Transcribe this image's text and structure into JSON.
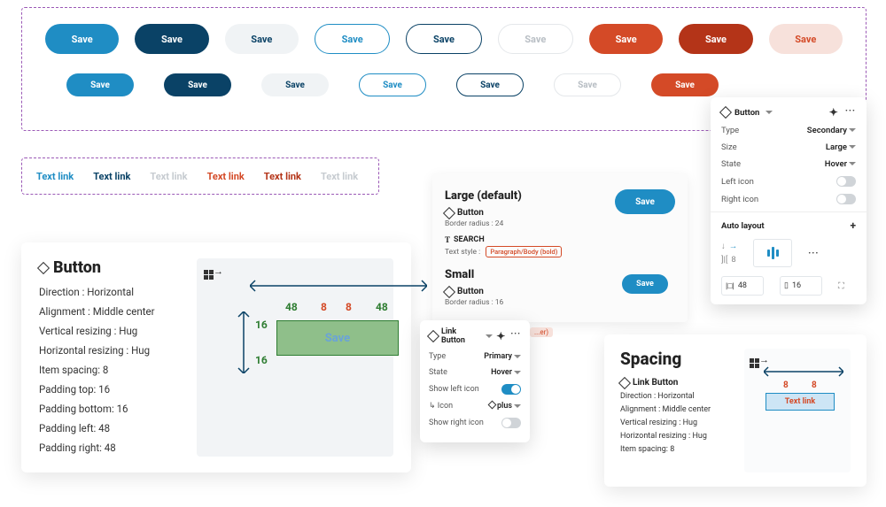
{
  "buttons": {
    "label": "Save",
    "row1_classes": [
      "fill-blue",
      "fill-navy",
      "fill-gray",
      "out-blue",
      "out-navy",
      "out-gray",
      "fill-red",
      "fill-dred",
      "fill-pink"
    ],
    "row2_classes": [
      "fill-blue",
      "fill-navy",
      "fill-gray",
      "out-blue",
      "out-navy",
      "out-gray",
      "fill-red"
    ]
  },
  "links": [
    {
      "text": "Text link",
      "color": "#1f8dc4"
    },
    {
      "text": "Text link",
      "color": "#0a4266"
    },
    {
      "text": "Text link",
      "color": "#c6cbd0"
    },
    {
      "text": "Text link",
      "color": "#d44a27"
    },
    {
      "text": "Text link",
      "color": "#b43418"
    },
    {
      "text": "Text link",
      "color": "#c6cbd0"
    }
  ],
  "spec": {
    "title": "Button",
    "props": [
      "Direction :  Horizontal",
      "Alignment :  Middle center",
      "Vertical resizing :  Hug",
      "Horizontal resizing :  Hug",
      "Item spacing:  8",
      "Padding top:  16",
      "Padding bottom:  16",
      "Padding left:  48",
      "Padding right:  48"
    ],
    "dia_label": "Save",
    "n48": "48",
    "n8": "8",
    "n16": "16"
  },
  "size_card": {
    "large_title": "Large (default)",
    "small_title": "Small",
    "comp": "Button",
    "br_large": "Border radius : 24",
    "br_small": "Border radius : 16",
    "search": "SEARCH",
    "text_style_label": "Text style :",
    "text_style_val": "Paragraph/Body (bold)",
    "save": "Save"
  },
  "link_panel": {
    "title": "Link Button",
    "type_label": "Type",
    "type_val": "Primary",
    "state_label": "State",
    "state_val": "Hover",
    "showleft": "Show left icon",
    "icon_label": "Icon",
    "icon_val": "plus",
    "showright": "Show right icon",
    "tag": "...er)"
  },
  "inspector": {
    "title": "Button",
    "type_label": "Type",
    "type_val": "Secondary",
    "size_label": "Size",
    "size_val": "Large",
    "state_label": "State",
    "state_val": "Hover",
    "lefticon": "Left icon",
    "righticon": "Right icon",
    "auto_layout": "Auto layout",
    "gap": "8",
    "pad_h": "48",
    "pad_v": "16"
  },
  "spacing": {
    "title": "Spacing",
    "comp": "Link Button",
    "props": [
      "Direction :  Horizontal",
      "Alignment :  Middle center",
      "Vertical resizing :  Hug",
      "Horizontal resizing :  Hug",
      "Item spacing:  8"
    ],
    "link": "Text link",
    "n8": "8"
  }
}
